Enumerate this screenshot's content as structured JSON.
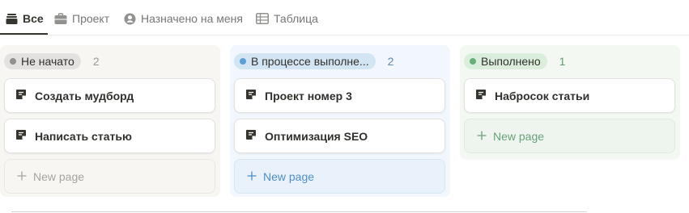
{
  "tabs": [
    {
      "label": "Все",
      "icon": "stack-icon",
      "active": true
    },
    {
      "label": "Проект",
      "icon": "briefcase-icon",
      "active": false
    },
    {
      "label": "Назначено на меня",
      "icon": "user-circle-icon",
      "active": false
    },
    {
      "label": "Таблица",
      "icon": "table-icon",
      "active": false
    }
  ],
  "columns": [
    {
      "status": "Не начато",
      "count": "2",
      "colors": {
        "background": "#f7f6f3",
        "pill": "#e3e2e0",
        "dot": "#91918e",
        "count": "#9b9a97",
        "new_page": "#a5a4a1"
      },
      "cards": [
        "Создать мудборд",
        "Написать статью"
      ],
      "new_page_label": "New page"
    },
    {
      "status": "В процессе выполне...",
      "count": "2",
      "colors": {
        "background": "#f1f7fc",
        "pill": "#d3e5f3",
        "dot": "#5aa0d7",
        "count": "#5b8ab2",
        "new_page": "#4e8ec7"
      },
      "cards": [
        "Проект номер 3",
        "Оптимизация SEO"
      ],
      "new_page_label": "New page"
    },
    {
      "status": "Выполнено",
      "count": "1",
      "colors": {
        "background": "#f3f8f3",
        "pill": "#dbeddb",
        "dot": "#6aae7a",
        "count": "#629b6d",
        "new_page": "#6aa07a"
      },
      "cards": [
        "Набросок статьи"
      ],
      "new_page_label": "New page"
    }
  ]
}
